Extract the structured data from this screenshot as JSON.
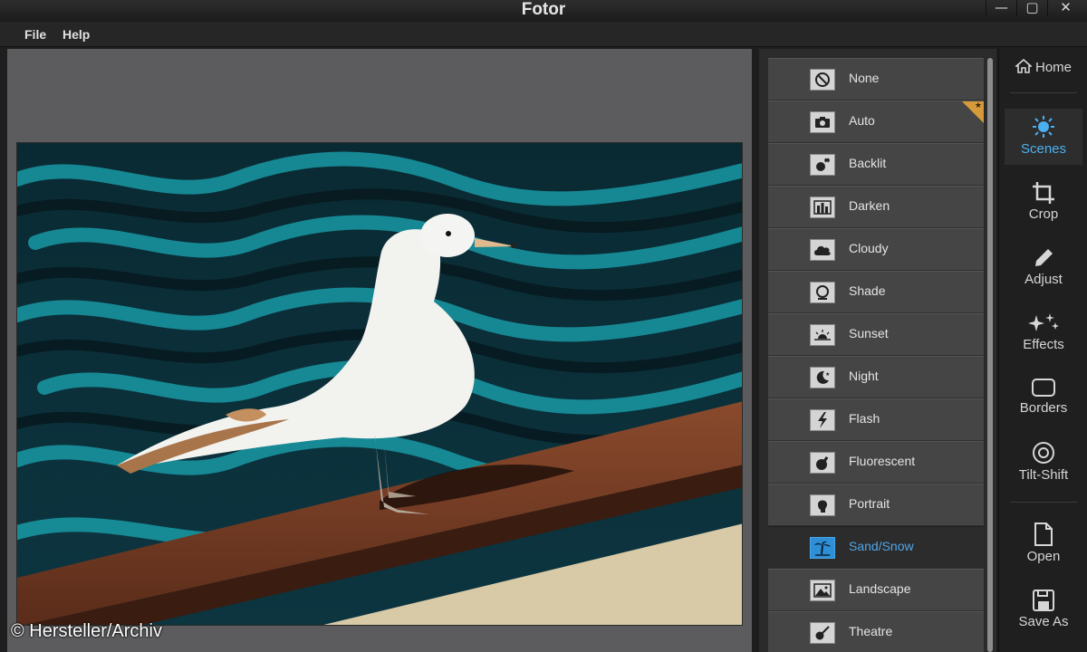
{
  "window": {
    "title": "Fotor",
    "controls": {
      "minimize": "—",
      "maximize": "▢",
      "close": "✕"
    }
  },
  "menu": {
    "file": "File",
    "help": "Help"
  },
  "watermark": "© Hersteller/Archiv",
  "scenes": [
    {
      "label": "None",
      "icon": "none-icon"
    },
    {
      "label": "Auto",
      "icon": "camera-icon"
    },
    {
      "label": "Backlit",
      "icon": "backlit-icon"
    },
    {
      "label": "Darken",
      "icon": "darken-icon"
    },
    {
      "label": "Cloudy",
      "icon": "cloud-icon"
    },
    {
      "label": "Shade",
      "icon": "shade-icon"
    },
    {
      "label": "Sunset",
      "icon": "sunset-icon"
    },
    {
      "label": "Night",
      "icon": "night-icon"
    },
    {
      "label": "Flash",
      "icon": "flash-icon"
    },
    {
      "label": "Fluorescent",
      "icon": "fluorescent-icon"
    },
    {
      "label": "Portrait",
      "icon": "portrait-icon"
    },
    {
      "label": "Sand/Snow",
      "icon": "palm-tree-icon"
    },
    {
      "label": "Landscape",
      "icon": "landscape-icon"
    },
    {
      "label": "Theatre",
      "icon": "guitar-icon"
    }
  ],
  "selected_scene": "Sand/Snow",
  "toolbar": {
    "home": "Home",
    "scenes": "Scenes",
    "crop": "Crop",
    "adjust": "Adjust",
    "effects": "Effects",
    "borders": "Borders",
    "tilt_shift": "Tilt-Shift",
    "open": "Open",
    "save_as": "Save As"
  },
  "colors": {
    "accent": "#4ab0f0",
    "selected_icon": "#2f8fd6",
    "badge": "#d79a3a"
  }
}
